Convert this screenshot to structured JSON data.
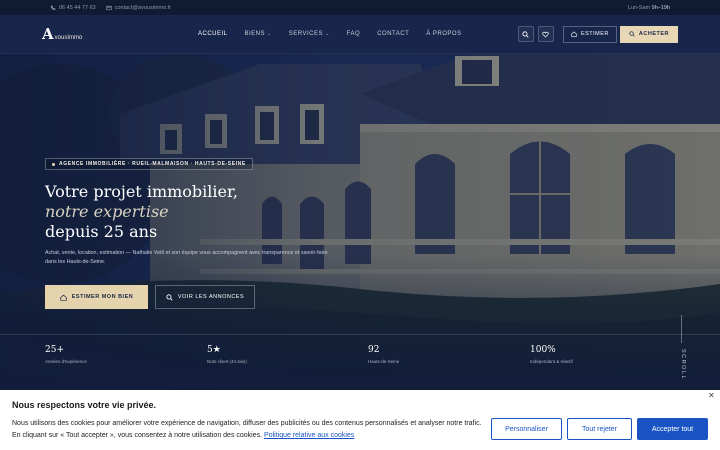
{
  "topbar": {
    "phone": "06 45 44 77 63",
    "email": "contact@avousimmo.fr",
    "hours_label": "Lun-Sam",
    "hours_value": "9h–19h"
  },
  "header": {
    "logo_mark": "A",
    "logo_word": "vousImmo",
    "nav": [
      {
        "label": "ACCUEIL"
      },
      {
        "label": "BIENS"
      },
      {
        "label": "SERVICES"
      },
      {
        "label": "FAQ"
      },
      {
        "label": "CONTACT"
      },
      {
        "label": "À PROPOS"
      }
    ],
    "estimer_label": "ESTIMER",
    "acheter_label": "ACHETER"
  },
  "hero": {
    "badge": "AGENCE IMMOBILIÈRE · RUEIL-MALMAISON · HAUTS-DE-SEINE",
    "title_line1": "Votre projet immobilier,",
    "title_line2": "notre expertise",
    "title_line3": "depuis 25 ans",
    "lead": "Achat, vente, location, estimation — Nathalie Vetil et son équipe vous accompagnent avec transparence et savoir-faire dans les Hauts-de-Seine.",
    "cta_primary": "ESTIMER MON BIEN",
    "cta_secondary": "VOIR LES ANNONCES",
    "scroll_label": "SCROLL",
    "stats": [
      {
        "value": "25+",
        "label": "Années d'expérience"
      },
      {
        "value": "5★",
        "label": "Note client (44 avis)"
      },
      {
        "value": "92",
        "label": "Hauts-de-Seine"
      },
      {
        "value": "100%",
        "label": "Indépendant & réactif"
      }
    ]
  },
  "cookie": {
    "title": "Nous respectons votre vie privée.",
    "text_line1": "Nous utilisons des cookies pour améliorer votre expérience de navigation, diffuser des publicités ou des contenus personnalisés et analyser notre trafic.",
    "text_line2": "En cliquant sur « Tout accepter », vous consentez à notre utilisation des cookies.",
    "policy_link": "Politique relative aux cookies",
    "btn_customize": "Personnaliser",
    "btn_reject": "Tout rejeter",
    "btn_accept": "Accepter tout",
    "close": "✕"
  },
  "colors": {
    "navy": "#17264a",
    "gold": "#e5d3ae",
    "link_blue": "#1a54c4"
  },
  "icons": [
    "phone-icon",
    "mail-icon",
    "search-icon",
    "heart-icon",
    "home-icon",
    "close-icon"
  ]
}
